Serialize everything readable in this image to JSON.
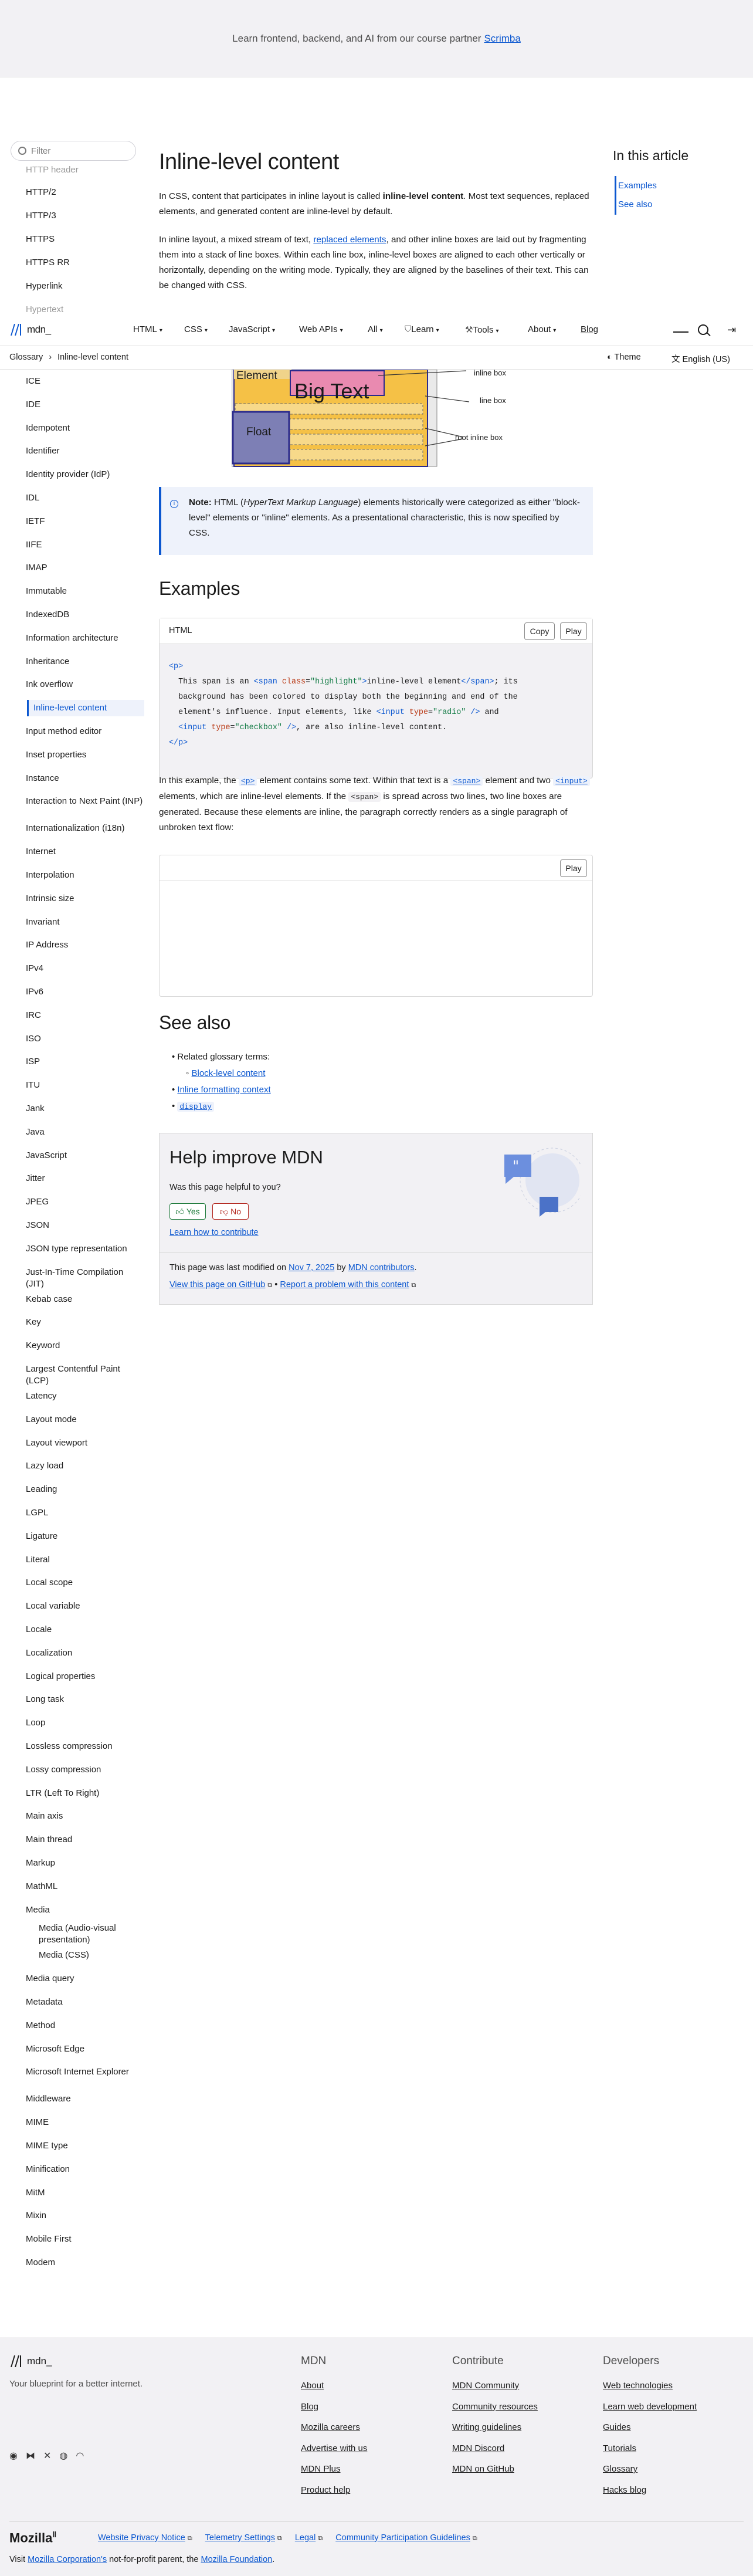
{
  "banner": {
    "text": "Learn frontend, backend, and AI from our course partner",
    "link": "Scrimba"
  },
  "header": {
    "logo": "mdn_",
    "nav": [
      "HTML",
      "CSS",
      "JavaScript",
      "Web APIs",
      "All",
      "Learn",
      "Tools",
      "About",
      "Blog"
    ],
    "search_label": "Search"
  },
  "breadcrumb": {
    "root": "Glossary",
    "current": "Inline-level content",
    "theme": "Theme",
    "language": "English (US)"
  },
  "sidebar": {
    "filter_placeholder": "Filter",
    "top_items": [
      "HTTP header",
      "HTTP/2",
      "HTTP/3",
      "HTTPS",
      "HTTPS RR",
      "Hyperlink",
      "Hypertext"
    ],
    "items": [
      "ICE",
      "IDE",
      "Idempotent",
      "Identifier",
      "Identity provider (IdP)",
      "IDL",
      "IETF",
      "IIFE",
      "IMAP",
      "Immutable",
      "IndexedDB",
      "Information architecture",
      "Inheritance",
      "Ink overflow",
      "Inline-level content",
      "Input method editor",
      "Inset properties",
      "Instance",
      "Interaction to Next Paint (INP)",
      "Internationalization (i18n)",
      "Internet",
      "Interpolation",
      "Intrinsic size",
      "Invariant",
      "IP Address",
      "IPv4",
      "IPv6",
      "IRC",
      "ISO",
      "ISP",
      "ITU",
      "Jank",
      "Java",
      "JavaScript",
      "Jitter",
      "JPEG",
      "JSON",
      "JSON type representation",
      "Just-In-Time Compilation (JIT)",
      "Kebab case",
      "Key",
      "Keyword",
      "Largest Contentful Paint (LCP)",
      "Latency",
      "Layout mode",
      "Layout viewport",
      "Lazy load",
      "Leading",
      "LGPL",
      "Ligature",
      "Literal",
      "Local scope",
      "Local variable",
      "Locale",
      "Localization",
      "Logical properties",
      "Long task",
      "Loop",
      "Lossless compression",
      "Lossy compression",
      "LTR (Left To Right)",
      "Main axis",
      "Main thread",
      "Markup",
      "MathML",
      "Media",
      "Media (Audio-visual presentation)",
      "Media (CSS)",
      "Media query",
      "Metadata",
      "Method",
      "Microsoft Edge",
      "Microsoft Internet Explorer",
      "Middleware",
      "MIME",
      "MIME type",
      "Minification",
      "MitM",
      "Mixin",
      "Mobile First",
      "Modem"
    ]
  },
  "article": {
    "title": "Inline-level content",
    "intro_1a": "In CSS, content that participates in inline layout is called",
    "intro_1b": "inline-level content",
    "intro_1c": ". Most text sequences, replaced elements, and generated content are inline-level by default.",
    "intro_2a": "In inline layout, a mixed stream of text,",
    "intro_2link": "replaced elements",
    "intro_2b": ", and other inline boxes are laid out by fragmenting them into a stack of line boxes. Within each line box, inline-level boxes are aligned to each other vertically or horizontally, depending on the writing mode. Typically, they are aligned by the baselines of their text. This can be changed with CSS.",
    "diagram": {
      "element": "Element",
      "big_text": "Big Text",
      "float": "Float",
      "label_inline": "inline box",
      "label_line": "line box",
      "label_root": "root inline box"
    },
    "note_label": "Note:",
    "note_a": "HTML (",
    "note_em": "HyperText Markup Language",
    "note_b": ") elements historically were categorized as either \"block-level\" elements or \"inline\" elements. As a presentational characteristic, this is now specified by CSS.",
    "examples_title": "Examples",
    "code_lang": "HTML",
    "copy_label": "Copy",
    "play_label": "Play",
    "example_text_1": "In this example, the",
    "example_code_p": "<p>",
    "example_text_2": "element contains some text. Within that text is a",
    "example_code_span": "<span>",
    "example_text_3": "element and two",
    "example_code_input": "<input>",
    "example_text_4": "elements, which are inline-level elements. If the",
    "example_code_span2": "<span>",
    "example_text_5": "is spread across two lines, two line boxes are generated. Because these elements are inline, the paragraph correctly renders as a single paragraph of unbroken text flow:",
    "see_also_title": "See also",
    "related_terms": "Related glossary terms:",
    "block_level": "Block-level content",
    "inline_formatting": "Inline formatting context",
    "display": "display"
  },
  "feedback": {
    "title": "Help improve MDN",
    "question": "Was this page helpful to you?",
    "yes": "Yes",
    "no": "No",
    "contribute": "Learn how to contribute",
    "modified_a": "This page was last modified on",
    "modified_date": "Nov 7, 2025",
    "modified_b": "by",
    "contributors": "MDN contributors",
    "github": "View this page on GitHub",
    "report": "Report a problem with this content"
  },
  "toc": {
    "title": "In this article",
    "items": [
      "Examples",
      "See also"
    ]
  },
  "footer": {
    "logo": "mdn_",
    "tagline": "Your blueprint for a better internet.",
    "cols": [
      {
        "title": "MDN",
        "links": [
          "About",
          "Blog",
          "Mozilla careers",
          "Advertise with us",
          "MDN Plus",
          "Product help"
        ]
      },
      {
        "title": "Contribute",
        "links": [
          "MDN Community",
          "Community resources",
          "Writing guidelines",
          "MDN Discord",
          "MDN on GitHub"
        ]
      },
      {
        "title": "Developers",
        "links": [
          "Web technologies",
          "Learn web development",
          "Guides",
          "Tutorials",
          "Glossary",
          "Hacks blog"
        ]
      }
    ],
    "mozilla": "Mozilla",
    "legal_links": [
      "Website Privacy Notice",
      "Telemetry Settings",
      "Legal",
      "Community Participation Guidelines"
    ],
    "bottom_a": "Visit",
    "bottom_link1": "Mozilla Corporation's",
    "bottom_b": "not-for-profit parent, the",
    "bottom_link2": "Mozilla Foundation",
    "bottom_c": "."
  },
  "colors": {
    "accent": "#0b57d0",
    "note_bg": "#eef2fb",
    "code_bg": "#f2f1f4",
    "diagram_yellow": "#f5c146",
    "diagram_pink": "#e98ab0"
  }
}
